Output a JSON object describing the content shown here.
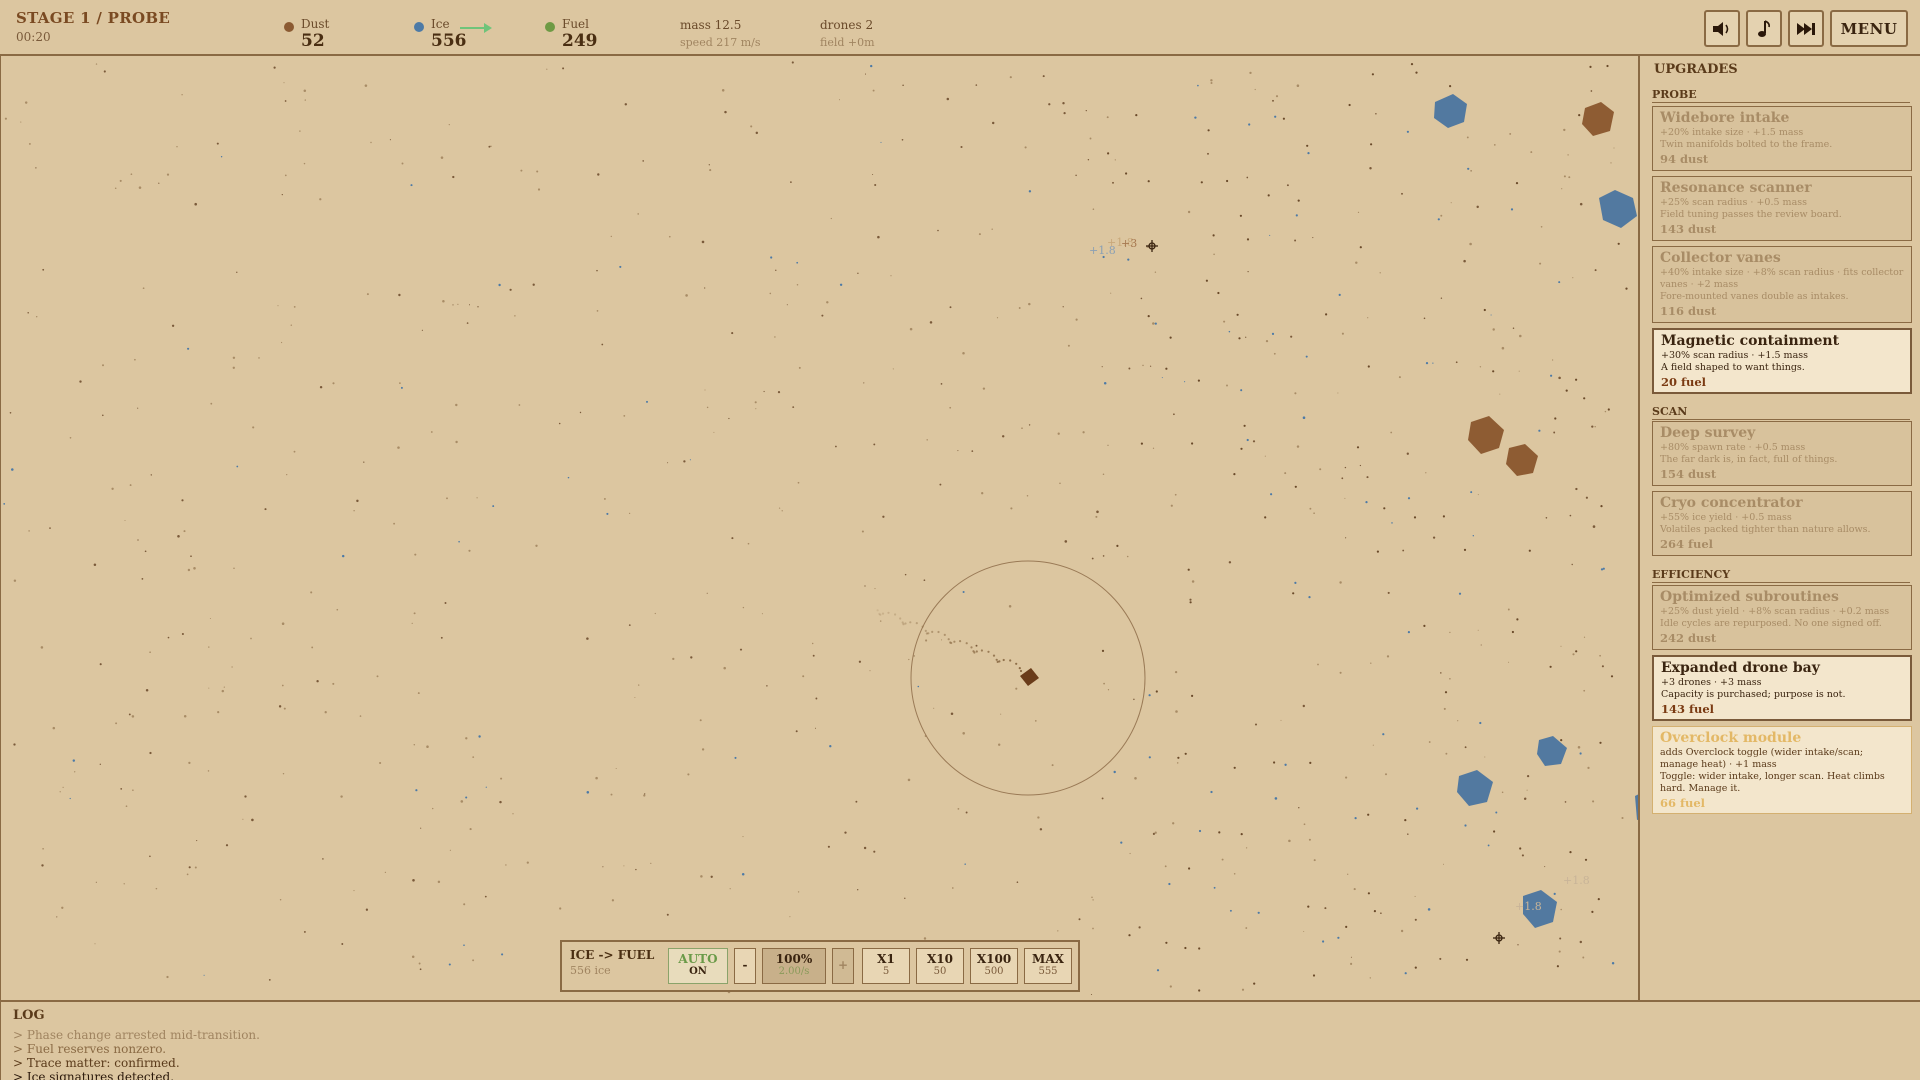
{
  "stage": {
    "title": "STAGE 1 / PROBE",
    "time": "00:20"
  },
  "resources": [
    {
      "label": "Dust",
      "value": "52",
      "color": "#8b5a32"
    },
    {
      "label": "Ice",
      "value": "556",
      "color": "#4d7aa6"
    },
    {
      "label": "Fuel",
      "value": "249",
      "color": "#6e9a44"
    }
  ],
  "stats": {
    "mass": "mass 12.5",
    "speed": "speed 217 m/s",
    "drones": "drones 2",
    "field": "field +0m"
  },
  "toolbar": {
    "mute_icon": "speaker-icon",
    "music_icon": "note-icon",
    "skip_icon": "fast-forward-icon",
    "menu_label": "MENU"
  },
  "converter": {
    "title": "ICE -> FUEL",
    "subtitle": "556 ice",
    "auto_label": "AUTO",
    "auto_state": "ON",
    "minus": "-",
    "rate_pct": "100%",
    "rate": "2.00/s",
    "plus": "+",
    "buttons": [
      {
        "label": "X1",
        "sub": "5"
      },
      {
        "label": "X10",
        "sub": "50"
      },
      {
        "label": "X100",
        "sub": "500"
      },
      {
        "label": "MAX",
        "sub": "555"
      }
    ]
  },
  "field": {
    "popups": [
      {
        "text": "+1.8",
        "color": "#8ba0b4"
      },
      {
        "text": "+1.8",
        "color": "#c8a87a"
      },
      {
        "text": "+3",
        "color": "#a67850"
      },
      {
        "text": "+1.8",
        "color": "#c8b498"
      },
      {
        "text": "+1.8",
        "color": "#c8b498"
      }
    ]
  },
  "log": {
    "title": "LOG",
    "lines": [
      {
        "text": "> Phase change arrested mid-transition.",
        "color": "#a08460"
      },
      {
        "text": "> Fuel reserves nonzero.",
        "color": "#8a6a44"
      },
      {
        "text": "> Trace matter: confirmed.",
        "color": "#5a3a1a"
      },
      {
        "text": "> Ice signatures detected.",
        "color": "#2a180a"
      }
    ]
  },
  "upgrades": {
    "title": "UPGRADES",
    "sections": [
      {
        "name": "PROBE"
      },
      {
        "name": "SCAN"
      },
      {
        "name": "EFFICIENCY"
      }
    ],
    "items": [
      {
        "name": "Widebore intake",
        "effect": "+20% intake size · +1.5 mass",
        "flavor": "Twin manifolds bolted to the frame.",
        "cost": "94 dust",
        "state": "off"
      },
      {
        "name": "Resonance scanner",
        "effect": "+25% scan radius · +0.5 mass",
        "flavor": "Field tuning passes the review board.",
        "cost": "143 dust",
        "state": "off"
      },
      {
        "name": "Collector vanes",
        "effect": "+40% intake size · +8% scan radius · fits collector vanes · +2 mass",
        "flavor": "Fore-mounted vanes double as intakes.",
        "cost": "116 dust",
        "state": "off"
      },
      {
        "name": "Magnetic containment",
        "effect": "+30% scan radius · +1.5 mass",
        "flavor": "A field shaped to want things.",
        "cost": "20 fuel",
        "state": "on"
      },
      {
        "name": "Deep survey",
        "effect": "+80% spawn rate · +0.5 mass",
        "flavor": "The far dark is, in fact, full of things.",
        "cost": "154 dust",
        "state": "off"
      },
      {
        "name": "Cryo concentrator",
        "effect": "+55% ice yield · +0.5 mass",
        "flavor": "Volatiles packed tighter than nature allows.",
        "cost": "264 fuel",
        "state": "off"
      },
      {
        "name": "Optimized subroutines",
        "effect": "+25% dust yield · +8% scan radius · +0.2 mass",
        "flavor": "Idle cycles are repurposed. No one signed off.",
        "cost": "242 dust",
        "state": "off"
      },
      {
        "name": "Expanded drone bay",
        "effect": "+3 drones · +3 mass",
        "flavor": "Capacity is purchased; purpose is not.",
        "cost": "143 fuel",
        "state": "on"
      },
      {
        "name": "Overclock module",
        "effect": "adds Overclock toggle (wider intake/scan; manage heat) · +1 mass",
        "flavor": "Toggle: wider intake, longer scan. Heat climbs hard. Manage it.",
        "cost": "66 fuel",
        "state": "spec"
      }
    ]
  }
}
